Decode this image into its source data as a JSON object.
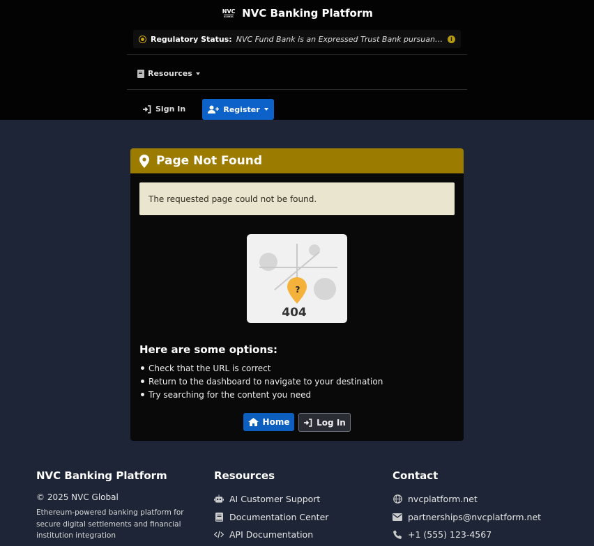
{
  "header": {
    "logo_text": "NVC",
    "logo_subtext": "GLOBAL",
    "title": "NVC Banking Platform",
    "regulatory_label": "Regulatory Status:",
    "regulatory_message": "NVC Fund Bank is an Expressed Trust Bank pursuant to African Union Treaty",
    "nav": {
      "resources_label": "Resources",
      "signin_label": "Sign In",
      "register_label": "Register"
    }
  },
  "card": {
    "title": "Page Not Found",
    "alert_text": "The requested page could not be found.",
    "illustration_code": "404",
    "illustration_marker": "?",
    "options_title": "Here are some options:",
    "options": [
      "Check that the URL is correct",
      "Return to the dashboard to navigate to your destination",
      "Try searching for the content you need"
    ],
    "home_button": "Home",
    "login_button": "Log In"
  },
  "footer": {
    "brand": {
      "title": "NVC Banking Platform",
      "copyright": "© 2025 NVC Global",
      "description": "Ethereum-powered banking platform for secure digital settlements and financial institution integration"
    },
    "resources": {
      "title": "Resources",
      "items": [
        {
          "label": "AI Customer Support",
          "icon": "robot-icon"
        },
        {
          "label": "Documentation Center",
          "icon": "book-icon"
        },
        {
          "label": "API Documentation",
          "icon": "code-icon"
        }
      ]
    },
    "contact": {
      "title": "Contact",
      "items": [
        {
          "label": "nvcplatform.net",
          "icon": "globe-icon"
        },
        {
          "label": "partnerships@nvcplatform.net",
          "icon": "envelope-icon"
        },
        {
          "label": "+1 (555) 123-4567",
          "icon": "phone-icon"
        }
      ]
    }
  },
  "colors": {
    "page_bg": "#1e2536",
    "header_bg": "#030303",
    "card_header": "#9c7c00",
    "alert_bg": "#eae5cf",
    "primary": "#0c62c9"
  }
}
